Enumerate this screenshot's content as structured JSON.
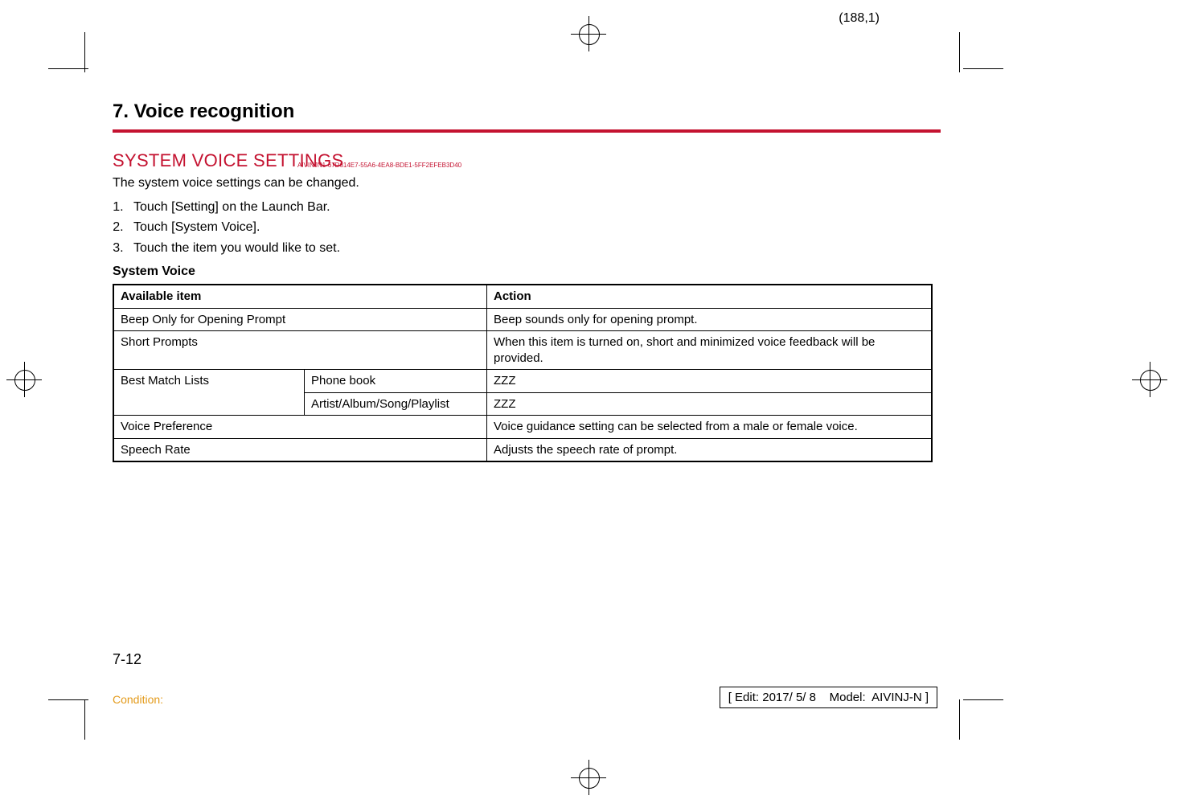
{
  "sheet_coord": "(188,1)",
  "chapter_title": "7. Voice recognition",
  "section_heading": "SYSTEM VOICE SETTINGS",
  "section_uid": "AIVINJN1-67D614E7-55A6-4EA8-BDE1-5FF2EFEB3D40",
  "intro_text": "The system voice settings can be changed.",
  "steps": [
    "Touch [Setting] on the Launch Bar.",
    "Touch [System Voice].",
    "Touch the item you would like to set."
  ],
  "table_title": "System Voice",
  "table_headers": {
    "item": "Available item",
    "action": "Action"
  },
  "rows": [
    {
      "item": "Beep Only for Opening Prompt",
      "sub": "",
      "action": "Beep sounds only for opening prompt."
    },
    {
      "item": "Short Prompts",
      "sub": "",
      "action": "When this item is turned on, short and minimized voice feedback will be provided."
    },
    {
      "item": "Best Match Lists",
      "sub": "Phone book",
      "action": "ZZZ"
    },
    {
      "item": "",
      "sub": "Artist/Album/Song/Playlist",
      "action": "ZZZ"
    },
    {
      "item": "Voice Preference",
      "sub": "",
      "action": "Voice guidance setting can be selected from a male or female voice."
    },
    {
      "item": "Speech Rate",
      "sub": "",
      "action": "Adjusts the speech rate of prompt."
    }
  ],
  "page_number": "7-12",
  "condition_label": "Condition:",
  "edit_box": "[ Edit: 2017/ 5/ 8    Model:  AIVINJ-N ]"
}
